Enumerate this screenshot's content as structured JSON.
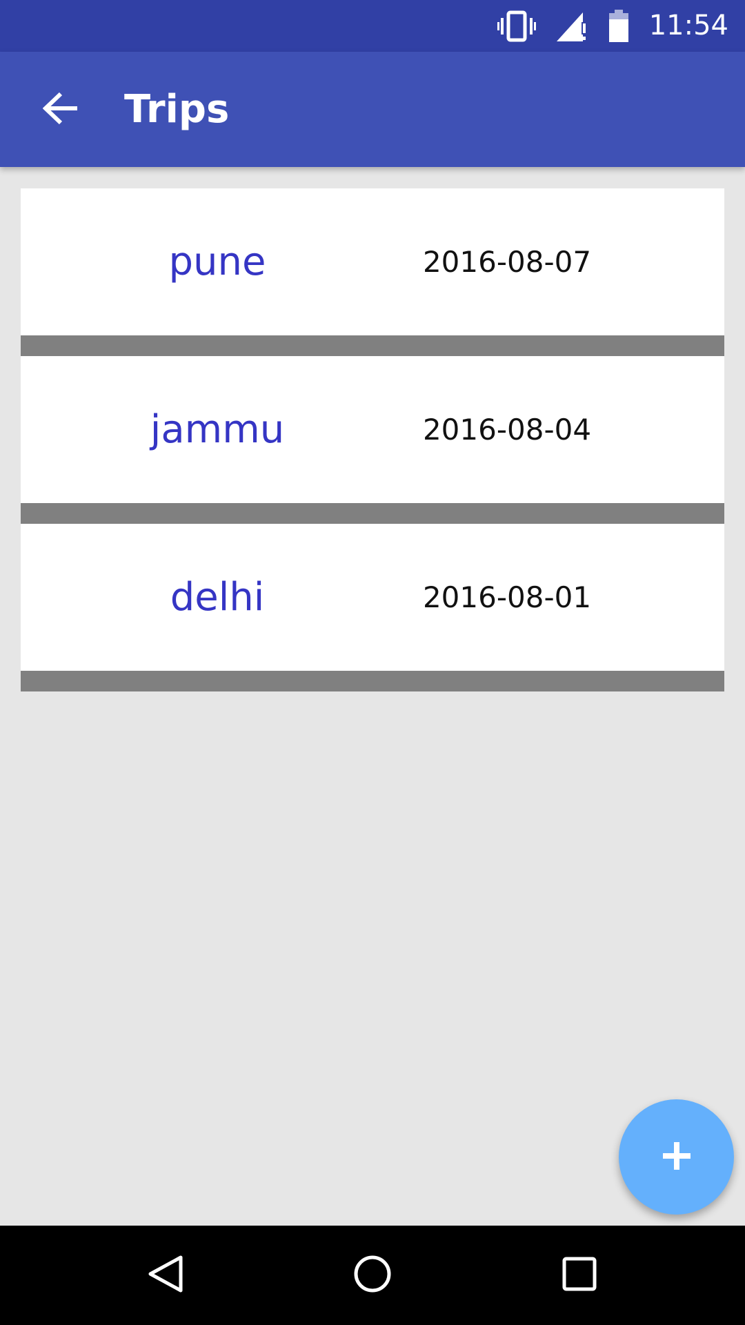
{
  "status_bar": {
    "time": "11:54",
    "icons": [
      "vibrate-icon",
      "signal-icon",
      "battery-icon"
    ]
  },
  "app_bar": {
    "title": "Trips",
    "back_icon": "arrow-back-icon"
  },
  "trips": [
    {
      "name": "pune",
      "date": "2016-08-07"
    },
    {
      "name": "jammu",
      "date": "2016-08-04"
    },
    {
      "name": "delhi",
      "date": "2016-08-01"
    }
  ],
  "fab": {
    "icon": "plus-icon"
  },
  "nav_bar": {
    "icons": [
      "back-triangle-icon",
      "home-circle-icon",
      "recents-square-icon"
    ]
  },
  "colors": {
    "status_bar": "#3140a5",
    "app_bar": "#3f51b5",
    "trip_name": "#3535c4",
    "divider": "#808080",
    "fab": "#64b0fc",
    "background": "#e6e6e6"
  }
}
